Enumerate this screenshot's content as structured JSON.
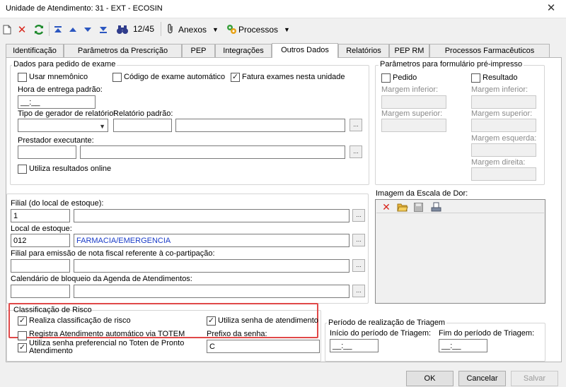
{
  "window": {
    "title": "Unidade de Atendimento: 31 - EXT - ECOSIN",
    "close_glyph": "✕"
  },
  "toolbar": {
    "counter": "12/45",
    "anexos_label": "Anexos",
    "processos_label": "Processos",
    "icons": [
      "new-document-icon",
      "delete-icon",
      "refresh-icon",
      "first-record-icon",
      "previous-record-icon",
      "next-record-icon",
      "last-record-icon",
      "binoculars-icon",
      "paperclip-icon",
      "processes-icon"
    ]
  },
  "tabs": [
    {
      "label": "Identificação"
    },
    {
      "label": "Parâmetros da Prescrição"
    },
    {
      "label": "PEP"
    },
    {
      "label": "Integrações"
    },
    {
      "label": "Outros Dados"
    },
    {
      "label": "Relatórios"
    },
    {
      "label": "PEP RM"
    },
    {
      "label": "Processos Farmacêuticos"
    }
  ],
  "active_tab": "Outros Dados",
  "exam": {
    "group_label": "Dados para pedido de exame",
    "usar_mnemonico": {
      "label": "Usar mnemônico",
      "checked": false
    },
    "codigo_automatico": {
      "label": "Código de exame automático",
      "checked": false
    },
    "fatura_exames": {
      "label": "Fatura exames nesta unidade",
      "checked": true
    },
    "hora_entrega_label": "Hora de entrega padrão:",
    "hora_entrega_value": "__:__",
    "tipo_gerador_label": "Tipo de gerador de relatório:",
    "relatorio_padrao_label": "Relatório padrão:",
    "prestador_label": "Prestador executante:",
    "utiliza_resultados": {
      "label": "Utiliza resultados online",
      "checked": false
    }
  },
  "preprinted": {
    "group_label": "Parâmetros para formulário pré-impresso",
    "pedido": {
      "label": "Pedido",
      "checked": false
    },
    "resultado": {
      "label": "Resultado",
      "checked": false
    },
    "margem_inferior": "Margem inferior:",
    "margem_superior": "Margem superior:",
    "margem_esquerda": "Margem esquerda:",
    "margem_direita": "Margem direita:"
  },
  "stock": {
    "filial_label": "Filial (do local de estoque):",
    "filial_code": "1",
    "filial_name": "",
    "local_label": "Local de estoque:",
    "local_code": "012",
    "local_name": "FARMACIA/EMERGENCIA",
    "filial_nf_label": "Filial para emissão de nota fiscal referente à co-partipação:",
    "calendario_label": "Calendário de bloqueio da Agenda de Atendimentos:"
  },
  "pain_scale": {
    "label": "Imagem da Escala de Dor:"
  },
  "risk": {
    "group_label": "Classificação de Risco",
    "realiza": {
      "label": "Realiza classificação de risco",
      "checked": true
    },
    "senha": {
      "label": "Utiliza senha de atendimento",
      "checked": true
    },
    "registra_totem": {
      "label": "Registra Atendimento automático via TOTEM",
      "checked": false
    },
    "senha_preferencial": {
      "label": "Utiliza senha preferencial no Toten de Pronto Atendimento",
      "checked": true
    },
    "prefixo_label": "Prefixo da senha:",
    "prefixo_value": "C"
  },
  "triage": {
    "group_label": "Período de realização de Triagem",
    "inicio_label": "Início do período de Triagem:",
    "inicio_value": "__:__",
    "fim_label": "Fim do período de Triagem:",
    "fim_value": "__:__"
  },
  "footer": {
    "ok": "OK",
    "cancelar": "Cancelar",
    "salvar": "Salvar"
  },
  "colors": {
    "highlight": "#e04848",
    "link_blue": "#1a3cc8"
  }
}
